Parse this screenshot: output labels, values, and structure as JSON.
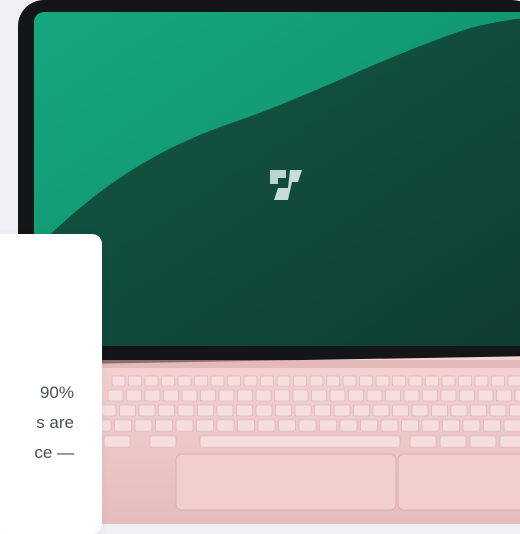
{
  "illustration": {
    "device": "laptop",
    "screen_colors": {
      "teal": "#16a27a",
      "dark": "#0f4a3a"
    },
    "body_color": "#efc9c9",
    "logo_icon": "brand-mark-icon"
  },
  "feature_card": {
    "lines": [
      "90%",
      "s are",
      "ce —"
    ]
  }
}
